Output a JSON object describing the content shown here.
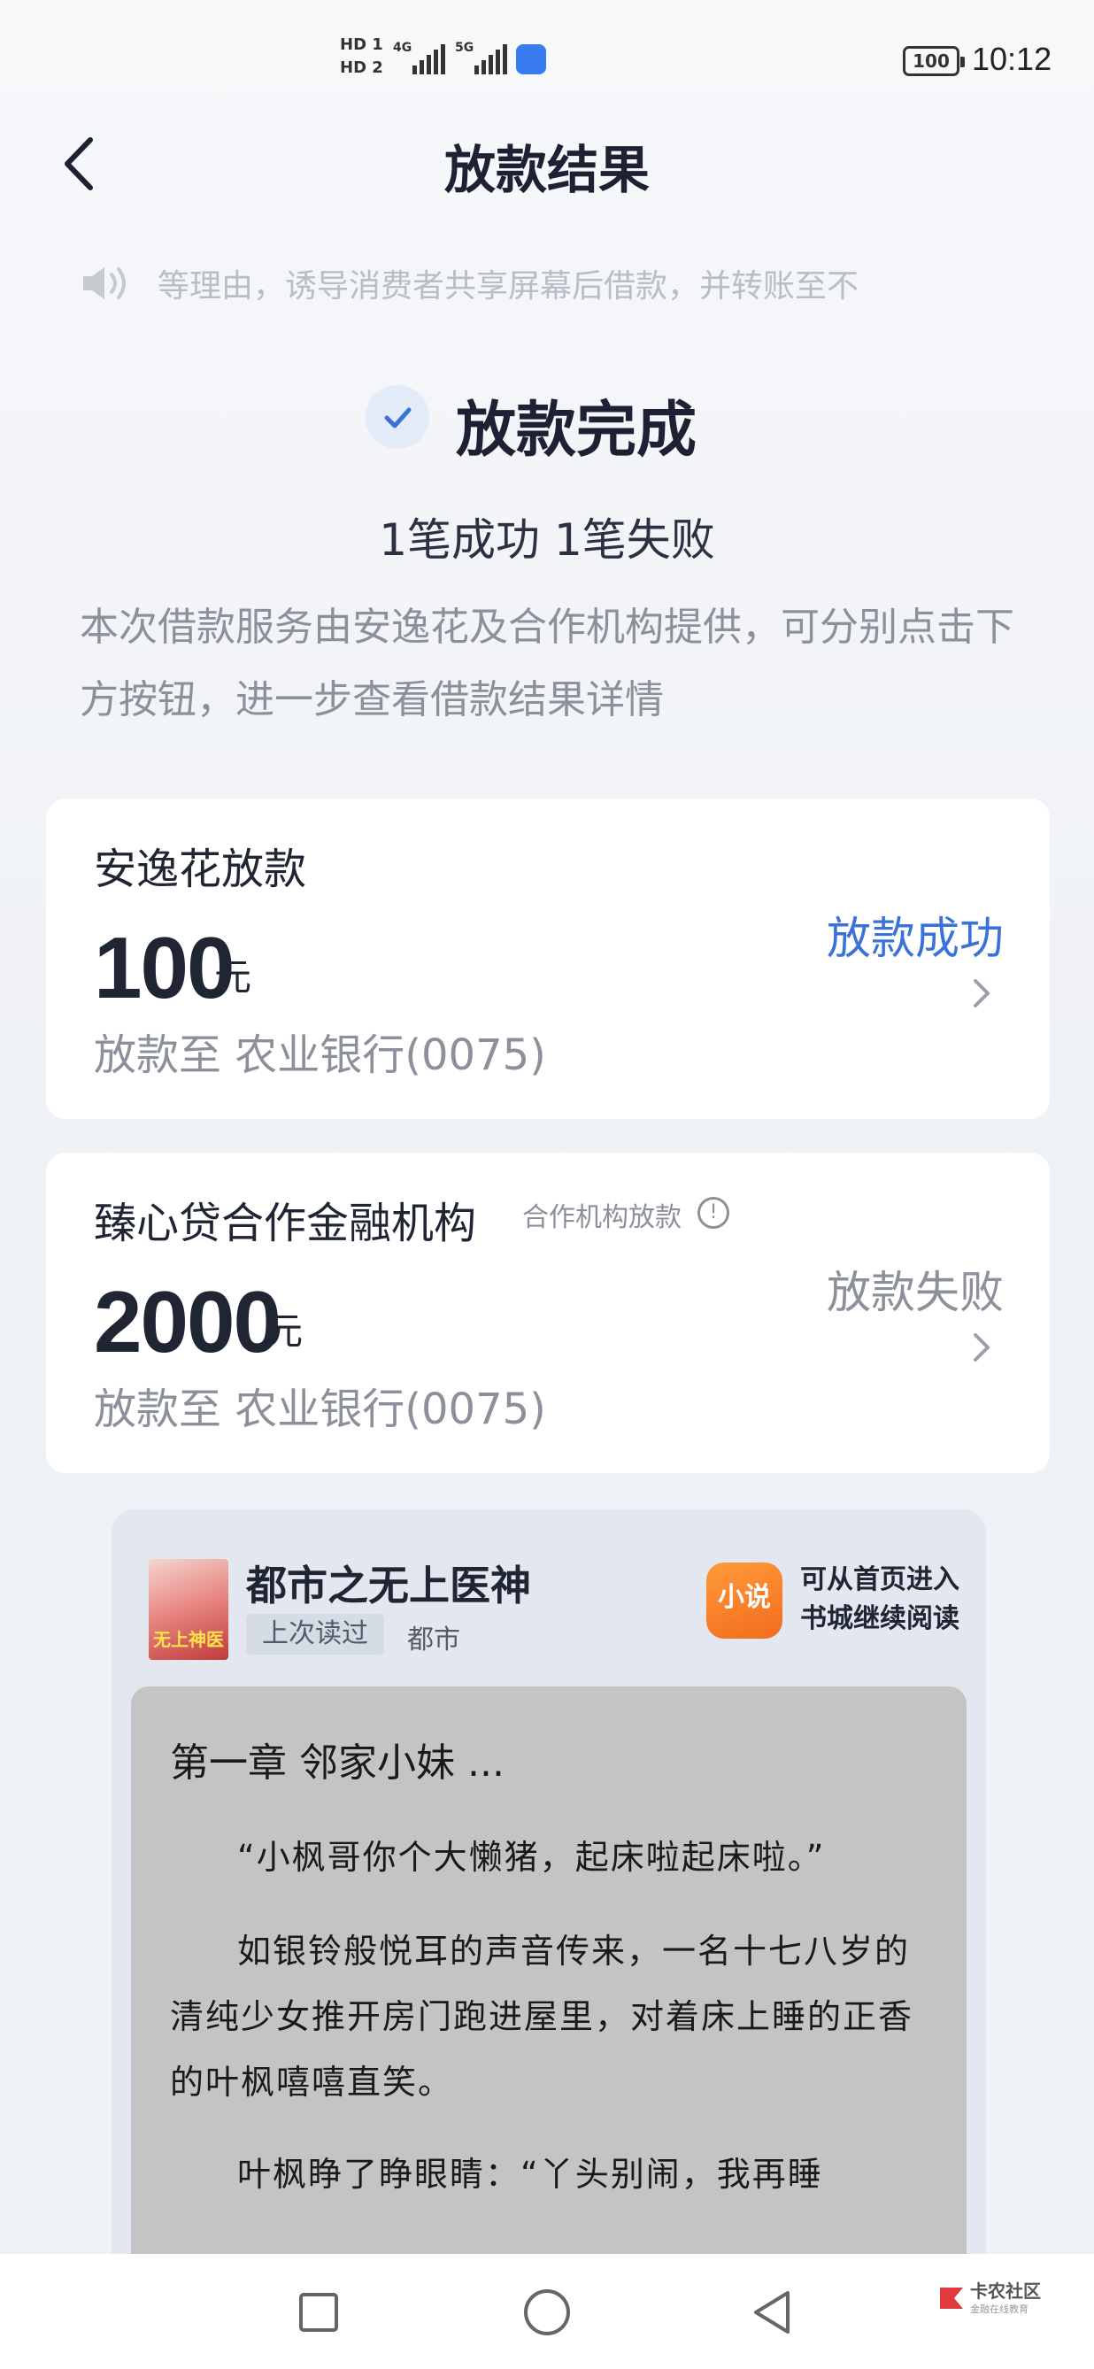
{
  "status_bar": {
    "sim_labels": "HD 1\nHD 2",
    "net1": "4G",
    "net2": "5G",
    "battery": "100",
    "time": "10:12"
  },
  "header": {
    "back_icon": "chevron-left-icon",
    "title": "放款结果"
  },
  "notice": {
    "icon": "speaker-icon",
    "text": "等理由，诱导消费者共享屏幕后借款，并转账至不"
  },
  "result": {
    "icon": "check-icon",
    "title": "放款完成",
    "summary": "1笔成功 1笔失败",
    "description": "本次借款服务由安逸花及合作机构提供，可分别点击下方按钮，进一步查看借款结果详情"
  },
  "loans": [
    {
      "name": "安逸花放款",
      "amount": "100",
      "unit": "元",
      "destination": "放款至 农业银行(0075)",
      "status": "放款成功",
      "status_color": "#3b72d9"
    },
    {
      "name": "臻心贷合作金融机构",
      "tag": "合作机构放款",
      "amount": "2000",
      "unit": "元",
      "destination": "放款至 农业银行(0075)",
      "status": "放款失败",
      "status_color": "#8b909a"
    }
  ],
  "novel": {
    "cover_text": "无上神医",
    "title": "都市之无上医神",
    "last_read": "上次读过",
    "genre": "都市",
    "app_icon_label": "小说",
    "app_hint": "可从首页进入书城继续阅读",
    "chapter": "第一章 邻家小妹 ...",
    "paragraphs": [
      "“小枫哥你个大懒猪，起床啦起床啦。”",
      "如银铃般悦耳的声音传来，一名十七八岁的清纯少女推开房门跑进屋里，对着床上睡的正香的叶枫嘻嘻直笑。",
      "叶枫睁了睁眼睛：“丫头别闹，我再睡"
    ]
  },
  "system_nav": {
    "items": [
      "recent-apps-icon",
      "home-icon",
      "back-icon"
    ]
  },
  "watermark": {
    "title": "卡农社区",
    "subtitle": "金融在线教育"
  }
}
